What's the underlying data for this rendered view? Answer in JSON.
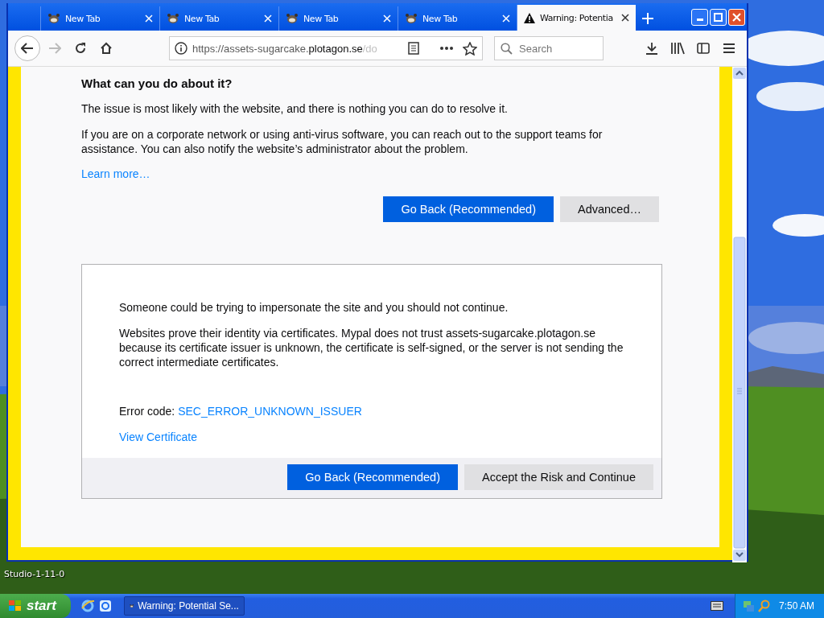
{
  "desktop": {
    "icon_label": "Studio-1-11-0"
  },
  "tabs": [
    {
      "title": "New Tab",
      "selected": false,
      "kind": "page"
    },
    {
      "title": "New Tab",
      "selected": false,
      "kind": "page"
    },
    {
      "title": "New Tab",
      "selected": false,
      "kind": "page"
    },
    {
      "title": "New Tab",
      "selected": false,
      "kind": "page"
    },
    {
      "title": "Warning: Potentia",
      "selected": true,
      "kind": "warning"
    }
  ],
  "address": {
    "parts": [
      {
        "text": "https://assets-sugarcake.",
        "kind": "dim"
      },
      {
        "text": "plotagon.se",
        "kind": "host"
      },
      {
        "text": "/do",
        "kind": "fade"
      }
    ]
  },
  "search": {
    "placeholder": "Search"
  },
  "page": {
    "heading": "What can you do about it?",
    "paragraphs": [
      "The issue is most likely with the website, and there is nothing you can do to resolve it.",
      "If you are on a corporate network or using anti-virus software, you can reach out to the support teams for assistance. You can also notify the website’s administrator about the problem."
    ],
    "link": "Learn more…",
    "buttons": [
      {
        "label": "Go Back (Recommended)",
        "kind": "primary"
      },
      {
        "label": "Advanced…",
        "kind": "secondary"
      }
    ]
  },
  "advanced": {
    "paragraphs": [
      "Someone could be trying to impersonate the site and you should not continue.",
      "Websites prove their identity via certificates. Mypal does not trust assets-sugarcake.plotagon.se because its certificate issuer is unknown, the certificate is self-signed, or the server is not sending the correct intermediate certificates."
    ],
    "error_label": "Error code:",
    "error_code": "SEC_ERROR_UNKNOWN_ISSUER",
    "view_certificate": "View Certificate",
    "buttons": [
      {
        "label": "Go Back (Recommended)",
        "kind": "primary"
      },
      {
        "label": "Accept the Risk and Continue",
        "kind": "secondary"
      }
    ]
  },
  "taskbar": {
    "start": "start",
    "task": "Warning: Potential Se...",
    "clock": "7:50 AM"
  }
}
